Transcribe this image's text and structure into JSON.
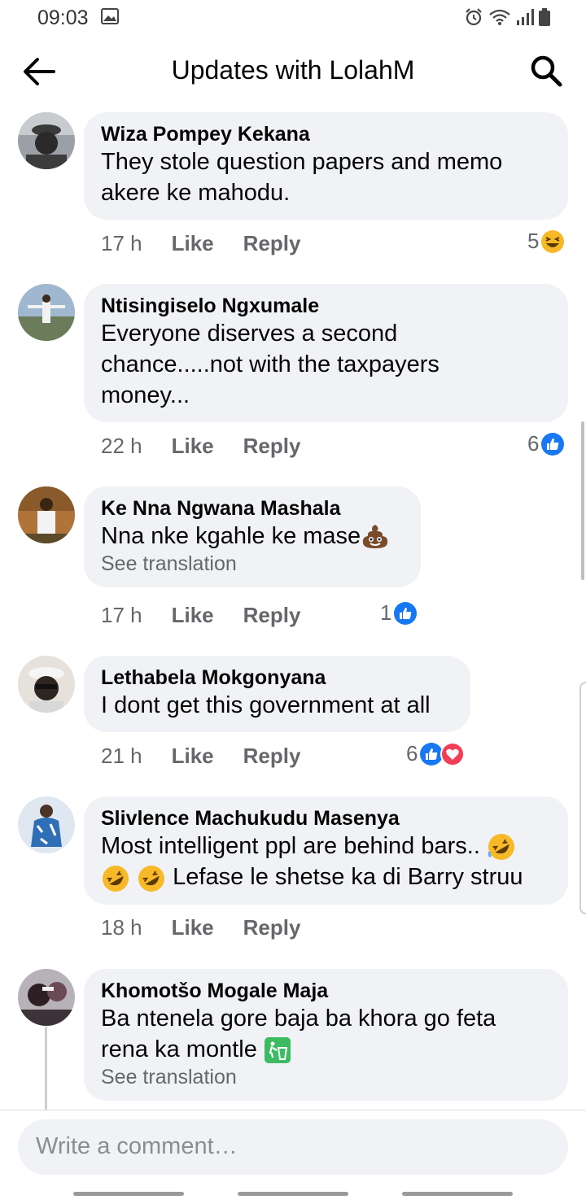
{
  "status": {
    "time": "09:03"
  },
  "header": {
    "title": "Updates with LolahM"
  },
  "comments": [
    {
      "author": "Wiza Pompey Kekana",
      "lines": [
        "They stole question papers and memo",
        "akere ke mahodu."
      ],
      "time": "17 h",
      "like": "Like",
      "reply": "Reply",
      "reaction_count": "5",
      "reactions": [
        "haha-emoji"
      ]
    },
    {
      "author": "Ntisingiselo Ngxumale",
      "lines": [
        "Everyone diserves a second",
        "chance.....not with the taxpayers",
        "money..."
      ],
      "time": "22 h",
      "like": "Like",
      "reply": "Reply",
      "reaction_count": "6",
      "reactions": [
        "like-emoji"
      ]
    },
    {
      "author": "Ke Nna Ngwana Mashala",
      "lines": [
        "Nna nke kgahle ke mase"
      ],
      "translate": "See translation",
      "time": "17 h",
      "like": "Like",
      "reply": "Reply",
      "reaction_count": "1",
      "reactions": [
        "like-emoji"
      ]
    },
    {
      "author": "Lethabela Mokgonyana",
      "lines": [
        "I dont get this government at all"
      ],
      "time": "21 h",
      "like": "Like",
      "reply": "Reply",
      "reaction_count": "6",
      "reactions": [
        "like-emoji",
        "love-emoji"
      ]
    },
    {
      "author": "Slivlence Machukudu Masenya",
      "lines": [
        "Most intelligent ppl are behind bars..",
        "Lefase le shetse ka di Barry struu"
      ],
      "time": "18 h",
      "like": "Like",
      "reply": "Reply",
      "reaction_count": "",
      "reactions": []
    },
    {
      "author": "Khomotšo Mogale Maja",
      "lines": [
        "Ba ntenela gore baja ba khora go feta",
        "rena ka montle"
      ],
      "translate": "See translation",
      "time": "",
      "like": "",
      "reply": "",
      "reaction_count": "",
      "reactions": []
    }
  ],
  "composer": {
    "placeholder": "Write a comment…"
  },
  "colors": {
    "accent": "#1877f2",
    "love": "#f33e58",
    "bubble": "#f0f2f5",
    "secondary_text": "#65676b"
  }
}
